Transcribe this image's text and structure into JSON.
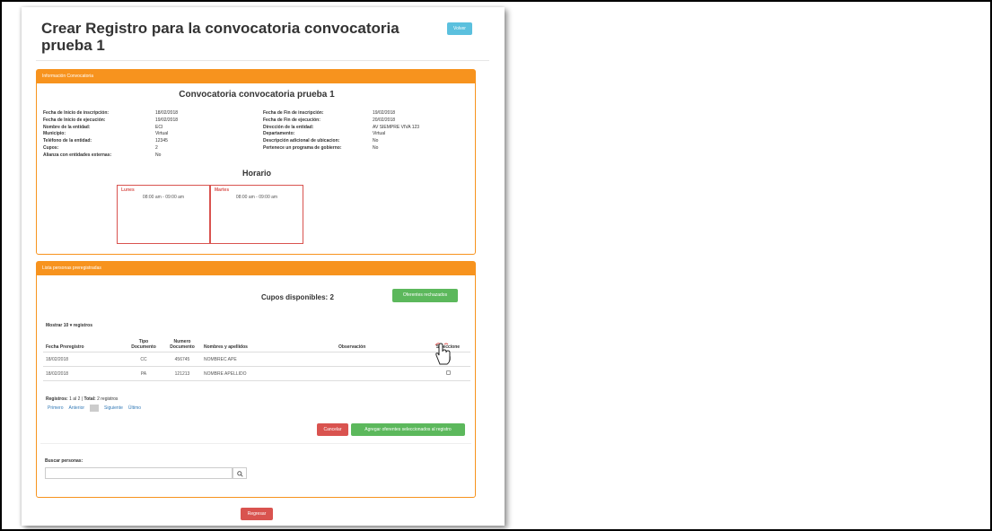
{
  "header": {
    "title": "Crear Registro para la convocatoria convocatoria prueba 1",
    "back_label": "Volver"
  },
  "info_panel": {
    "heading": "Información Convocatoria",
    "conv_title": "Convocatoria convocatoria prueba 1",
    "left": [
      {
        "label": "Fecha de Inicio de inscripción:",
        "value": "18/02/2018"
      },
      {
        "label": "Fecha de Inicio de ejecución:",
        "value": "19/02/2018"
      },
      {
        "label": "Nombre de la entidad:",
        "value": "ECI"
      },
      {
        "label": "Municipio:",
        "value": "Virtual"
      },
      {
        "label": "Teléfono de la entidad:",
        "value": "12345"
      },
      {
        "label": "Cupos:",
        "value": "2"
      },
      {
        "label": "Alianza con entidades externas:",
        "value": "No"
      }
    ],
    "right": [
      {
        "label": "Fecha de Fin de inscripción:",
        "value": "19/02/2018"
      },
      {
        "label": "Fecha de Fin de ejecución:",
        "value": "20/02/2018"
      },
      {
        "label": "Dirección de la entidad:",
        "value": "AV SIEMPRE VIVA 123"
      },
      {
        "label": "Departamento:",
        "value": "Virtual"
      },
      {
        "label": "Descripción adicional de ubicacion:",
        "value": "No"
      },
      {
        "label": "Pertenece un programa de gobierno:",
        "value": "No"
      }
    ],
    "horario_title": "Horario",
    "days": [
      {
        "name": "Lunes",
        "time": "08:00 am - 09:00 am"
      },
      {
        "name": "Martes",
        "time": "08:00 am - 09:00 am"
      }
    ]
  },
  "list_panel": {
    "heading": "Lista personas preregistradas",
    "cupos": "Cupos disponibles: 2",
    "rejected_button": "Oferentes rechazados",
    "mostrar_prefix": "Mostrar",
    "page_size": "10",
    "mostrar_suffix": "registros",
    "columns": [
      "Fecha Preregistro",
      "Tipo Documento",
      "Numero Documento",
      "Nombres y apellidos",
      "Observación",
      "Seleccione"
    ],
    "rows": [
      {
        "fecha": "18/02/2018",
        "tipo": "CC",
        "numero": "456745",
        "nombre": "NOMBREC APE",
        "obs": ""
      },
      {
        "fecha": "18/02/2018",
        "tipo": "PA",
        "numero": "121213",
        "nombre": "NOMBRE APELLIDO",
        "obs": ""
      }
    ],
    "registros_label": "Registros:",
    "registros_range": "1 al 2",
    "total_label": "Total:",
    "total_value": "2 registros",
    "pager": {
      "first": "Primero",
      "prev": "Anterior",
      "current": "1",
      "next": "Siguiente",
      "last": "Último"
    },
    "cancel_button": "Cancelar",
    "add_button": "Agregar oferentes seleccionados al registro",
    "search_label": "Buscar personas:",
    "search_value": ""
  },
  "footer": {
    "back_button": "Regresar"
  },
  "colors": {
    "orange": "#f7931e",
    "green": "#5cb85c",
    "red": "#d9534f",
    "info": "#5bc0de"
  }
}
